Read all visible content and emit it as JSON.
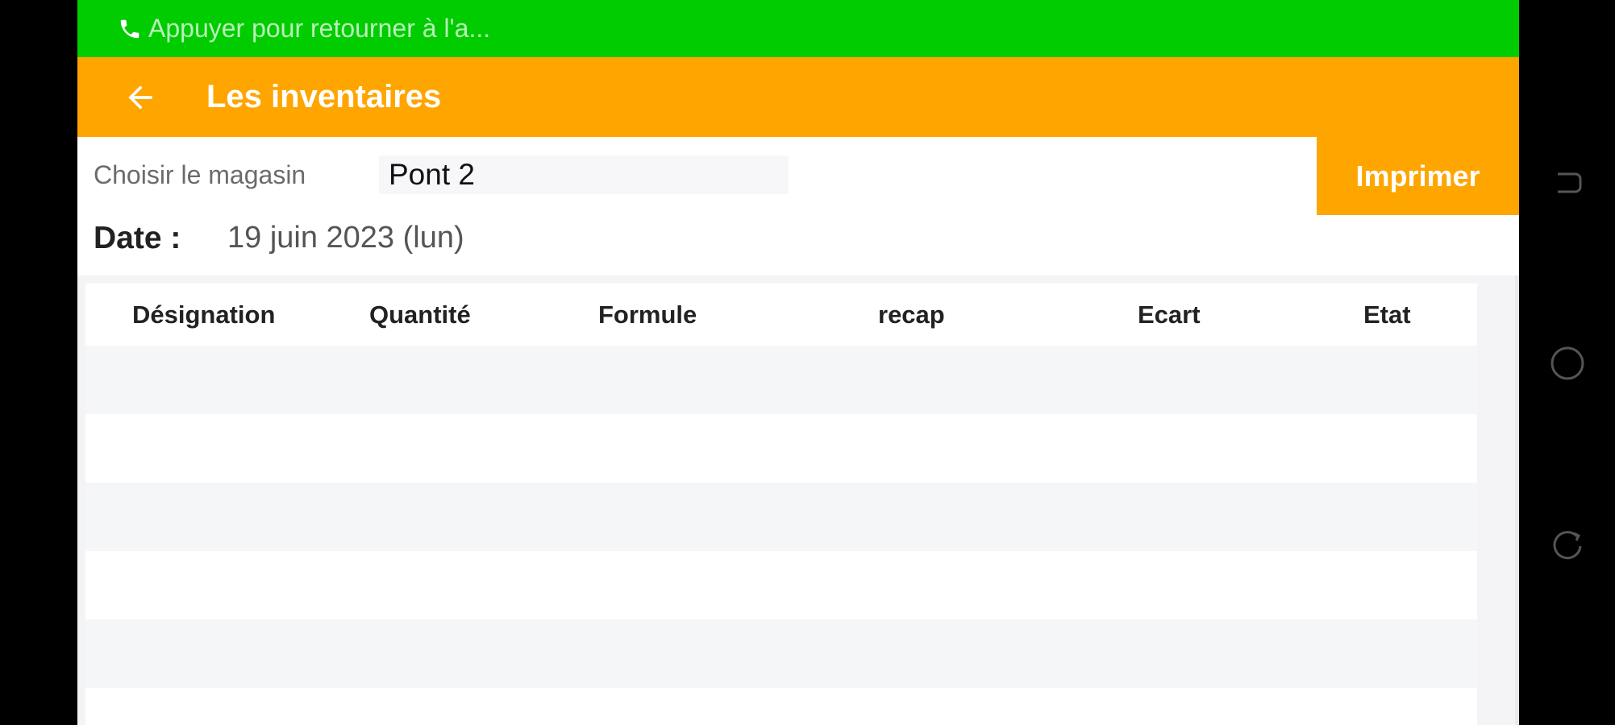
{
  "call_banner": {
    "text": "Appuyer pour retourner à l'a...",
    "icon": "phone-icon"
  },
  "app_bar": {
    "back_icon": "arrow-left-icon",
    "title": "Les inventaires"
  },
  "filters": {
    "store_label": "Choisir le magasin",
    "store_value": "Pont 2",
    "print_label": "Imprimer",
    "date_label": "Date :",
    "date_value": "19 juin 2023 (lun)"
  },
  "table": {
    "columns": [
      "Désignation",
      "Quantité",
      "Formule",
      "recap",
      "Ecart",
      "Etat"
    ],
    "rows": []
  },
  "nav_bar": {
    "buttons": [
      "back-nav-icon",
      "home-nav-icon",
      "recents-nav-icon"
    ]
  },
  "colors": {
    "call_banner": "#00cc00",
    "accent": "#ffa500"
  }
}
